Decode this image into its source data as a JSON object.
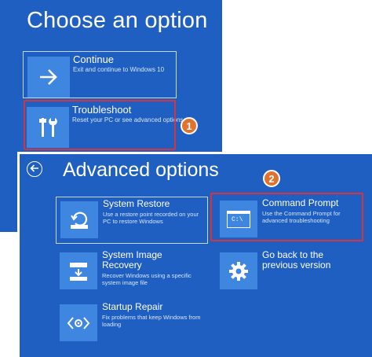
{
  "screen1": {
    "title": "Choose an option",
    "options": [
      {
        "title": "Continue",
        "desc": "Exit and continue to Windows 10",
        "icon": "arrow-right-icon"
      },
      {
        "title": "Troubleshoot",
        "desc": "Reset your PC or see advanced options",
        "icon": "tools-icon"
      }
    ]
  },
  "screen2": {
    "title": "Advanced options",
    "back_icon": "back-arrow-icon",
    "items": [
      {
        "title": "System Restore",
        "desc1": "Use a restore point recorded on your",
        "desc2": "PC to restore Windows",
        "icon": "restore-icon"
      },
      {
        "title": "Command Prompt",
        "desc1": "Use the Command Prompt for",
        "desc2": "advanced troubleshooting",
        "icon": "command-prompt-icon",
        "icon_text": "C:\\"
      },
      {
        "title1": "System Image",
        "title2": "Recovery",
        "desc1": "Recover Windows using a specific",
        "desc2": "system image file",
        "icon": "system-image-icon"
      },
      {
        "title1": "Go back to the",
        "title2": "previous version",
        "icon": "gear-icon"
      },
      {
        "title": "Startup Repair",
        "desc1": "Fix problems that keep Windows from",
        "desc2": "loading",
        "icon": "startup-repair-icon"
      }
    ]
  },
  "callouts": [
    {
      "number": "1"
    },
    {
      "number": "2"
    }
  ],
  "colors": {
    "background": "#1f5fc2",
    "tile": "#3f86e0",
    "highlight": "#d8333d",
    "badge": "#e0722e"
  }
}
